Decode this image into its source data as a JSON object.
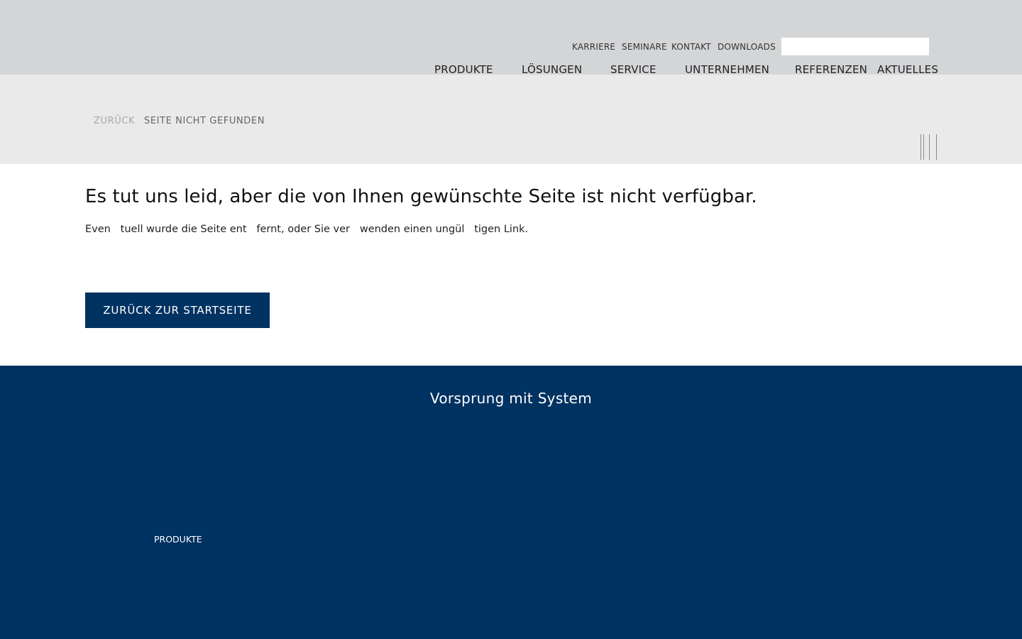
{
  "header": {
    "meta_nav": [
      "KARRIERE",
      "SEMINARE",
      "KONTAKT",
      "DOWNLOADS"
    ],
    "search": {
      "value": "",
      "placeholder": ""
    },
    "main_nav": [
      "PRODUKTE",
      "LÖSUNGEN",
      "SERVICE",
      "UNTERNEHMEN",
      "REFERENZEN",
      "AKTUELLES"
    ]
  },
  "breadcrumb": {
    "back": "ZURÜCK",
    "current": "SEITE NICHT GEFUNDEN"
  },
  "content": {
    "headline": "Es tut uns leid, aber die von Ihnen gewünschte Seite ist nicht verfügbar.",
    "text": "Even   tuell wurde die Seite ent   fernt, oder Sie ver   wenden einen ungül   tigen Link.",
    "button_label": "ZURÜCK ZUR STARTSEITE"
  },
  "footer": {
    "slogan": "Vorsprung mit System",
    "link": "PRODUKTE"
  },
  "colors": {
    "header_bg": "#d4d5d7",
    "subheader_bg": "#eaeaea",
    "brand_navy": "#003262"
  }
}
